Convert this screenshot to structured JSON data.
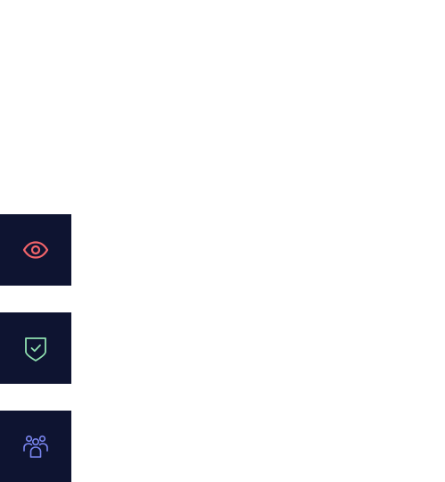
{
  "colors": {
    "page_background": "#ffffff",
    "tile_background": "#0e1431"
  },
  "feature_tiles": [
    {
      "icon": "eye-icon",
      "color": "#f2646a"
    },
    {
      "icon": "shield-check-icon",
      "color": "#8fe0b0"
    },
    {
      "icon": "users-icon",
      "color": "#7b87f2"
    }
  ]
}
